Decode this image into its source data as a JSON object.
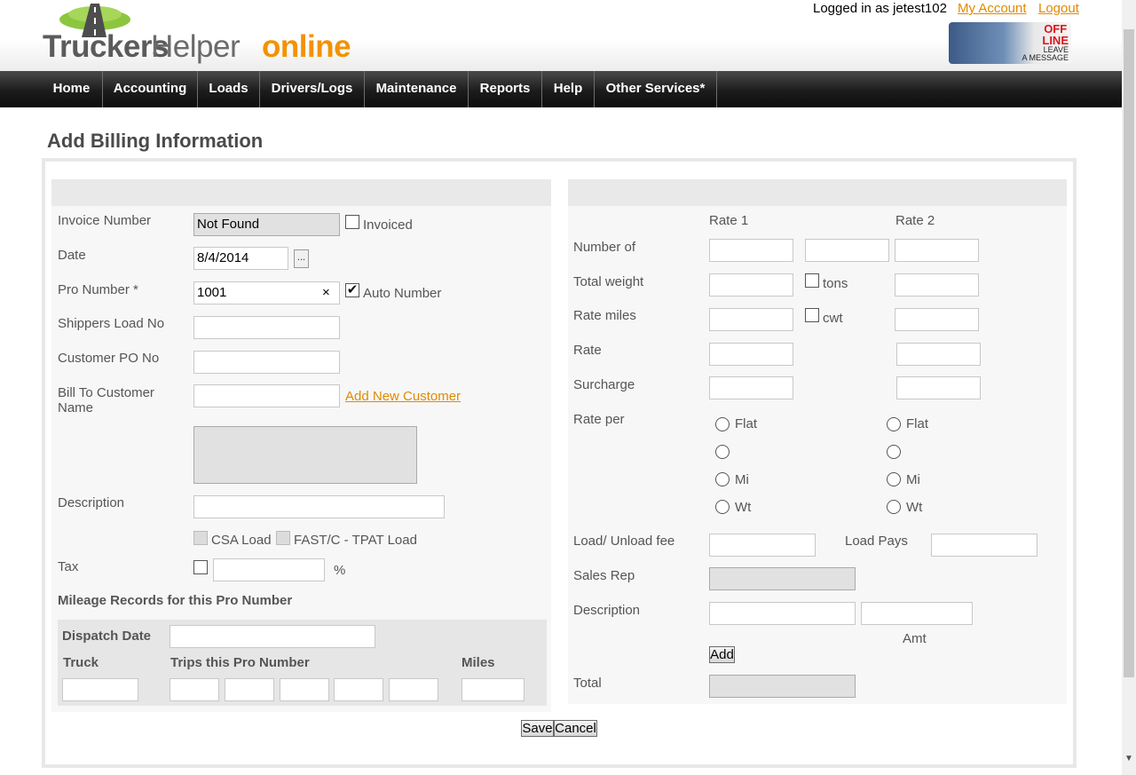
{
  "header": {
    "logo": {
      "part1": "Truckers",
      "part2": "Helper",
      "part3": "online"
    },
    "login_status": "Logged in as jetest102",
    "my_account": "My Account",
    "logout": "Logout",
    "chat_badge": {
      "status_line1": "OFF",
      "status_line2": "LINE",
      "action_line1": "LEAVE",
      "action_line2": "A MESSAGE"
    }
  },
  "nav": {
    "items": [
      "Home",
      "Accounting",
      "Loads",
      "Drivers/Logs",
      "Maintenance",
      "Reports",
      "Help",
      "Other Services*"
    ]
  },
  "page_title": "Add Billing Information",
  "left": {
    "invoice_number_label": "Invoice Number",
    "invoice_number_value": "Not Found",
    "invoiced_label": "Invoiced",
    "date_label": "Date",
    "date_value": "8/4/2014",
    "date_picker_label": "...",
    "pro_number_label": "Pro Number *",
    "pro_number_value": "1001",
    "pro_number_clear": "×",
    "auto_number_label": "Auto Number",
    "auto_number_mark": "✔",
    "shippers_load_label": "Shippers Load No",
    "customer_po_label": "Customer PO No",
    "bill_to_label_line1": "Bill To Customer",
    "bill_to_label_line2": "Name",
    "add_new_customer": "Add New Customer",
    "description_label": "Description",
    "csa_load_label": "CSA Load",
    "fast_label": "FAST/C - TPAT Load",
    "tax_label": "Tax",
    "tax_percent": "%",
    "mileage_heading": "Mileage Records for this Pro Number",
    "dispatch_date_label": "Dispatch Date",
    "truck_label": "Truck",
    "trips_label": "Trips this Pro Number",
    "miles_label": "Miles"
  },
  "right": {
    "rate1_label": "Rate 1",
    "rate2_label": "Rate 2",
    "number_of_label": "Number of",
    "total_weight_label": "Total weight",
    "tons_label": "tons",
    "rate_miles_label": "Rate miles",
    "cwt_label": "cwt",
    "rate_label": "Rate",
    "surcharge_label": "Surcharge",
    "rate_per_label": "Rate per",
    "rate_per_options": [
      "Flat",
      "",
      "Mi",
      "Wt"
    ],
    "load_unload_label": "Load/ Unload fee",
    "load_pays_label": "Load Pays",
    "sales_rep_label": "Sales Rep",
    "description_label": "Description",
    "amt_label": "Amt",
    "add_button": "Add",
    "total_label": "Total"
  },
  "actions": {
    "save": "Save",
    "cancel": "Cancel"
  },
  "colors": {
    "accent": "#f39200",
    "link": "#e08a00",
    "nav_bg": "#1c1c1c",
    "panel_bg": "#f7f7f7"
  }
}
